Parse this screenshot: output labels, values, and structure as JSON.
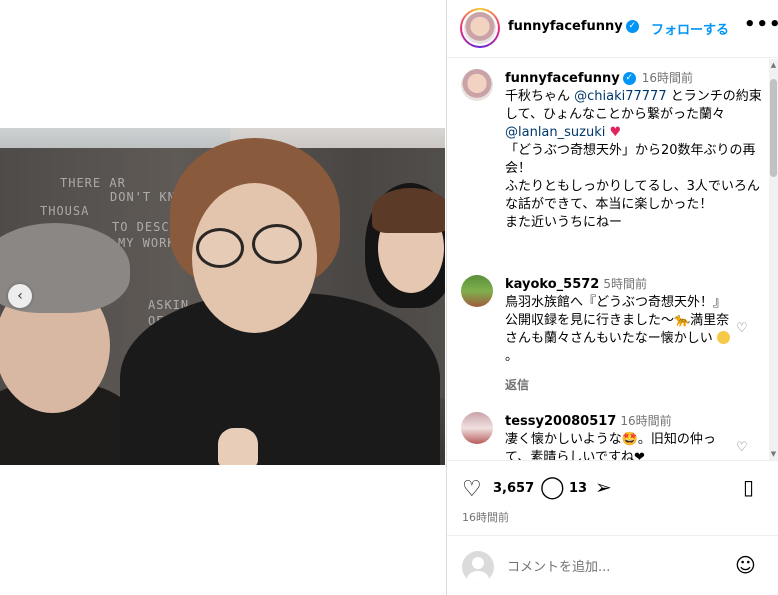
{
  "post": {
    "username": "funnyfacefunny",
    "follow_label": "フォローする",
    "more_label": "•••"
  },
  "caption": {
    "username": "funnyfacefunny",
    "time": "16時間前",
    "text_1": "千秋ちゃん ",
    "mention_1": "@chiaki77777",
    "text_2": " とランチの約束して、ひょんなことから繋がった蘭々 ",
    "mention_2": "@lanlan_suzuki",
    "heart": "♥",
    "text_3": "\n「どうぶつ奇想天外」から20数年ぶりの再会！\nふたりともしっかりしてるし、3人でいろんな話ができて、本当に楽しかった！\nまた近いうちにねー"
  },
  "comments": [
    {
      "username": "kayoko_5572",
      "time": "5時間前",
      "text": "鳥羽水族館へ『どうぶつ奇想天外！』公開収録を見に行きました〜🐆満里奈さんも蘭々さんもいたなー懐かしい",
      "reply_label": "返信"
    },
    {
      "username": "tessy20080517",
      "time": "16時間前",
      "text": "凄く懐かしいような🤩。旧知の仲って、素晴らしいですね❤"
    }
  ],
  "actions": {
    "like_count": "3,657",
    "comment_count": "13",
    "post_time": "16時間前"
  },
  "add_comment": {
    "placeholder": "コメントを追加..."
  },
  "photo": {
    "wall_text_1": "THERE AR",
    "wall_text_2": "DON'T KNOW",
    "wall_text_3": "THOUSA",
    "wall_text_4": "TO DESCRIBE",
    "wall_text_5": "MY WORK",
    "wall_text_6": "ASKIN",
    "wall_text_7": "OES YOU"
  },
  "icons": {
    "heart": "heart-icon",
    "comment": "comment-icon",
    "share": "share-icon",
    "save": "bookmark-icon",
    "emoji": "emoji-icon",
    "more": "more-icon",
    "verified": "verified-icon",
    "carousel_prev": "chevron-left-icon"
  },
  "colors": {
    "accent": "#0095f6",
    "mention": "#00376b",
    "muted": "#737373"
  }
}
